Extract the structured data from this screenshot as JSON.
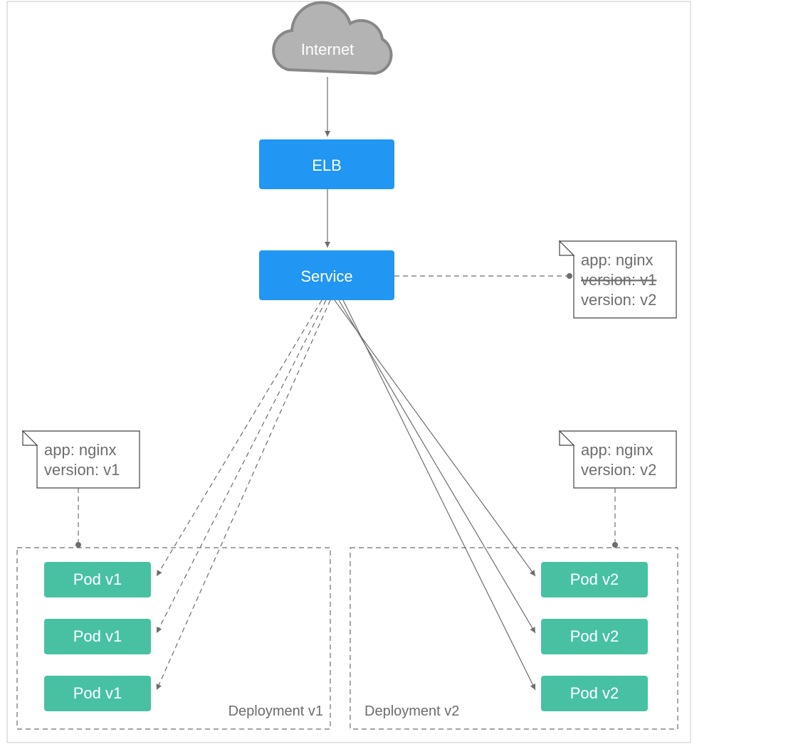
{
  "cloud": {
    "label": "Internet"
  },
  "elb": {
    "label": "ELB"
  },
  "service": {
    "label": "Service"
  },
  "serviceNote": {
    "line1": "app: nginx",
    "line2": "version: v1",
    "line3": "version: v2"
  },
  "deploymentV1": {
    "title": "Deployment v1",
    "note": {
      "line1": "app: nginx",
      "line2": "version: v1"
    },
    "pods": [
      "Pod v1",
      "Pod v1",
      "Pod v1"
    ]
  },
  "deploymentV2": {
    "title": "Deployment v2",
    "note": {
      "line1": "app: nginx",
      "line2": "version: v2"
    },
    "pods": [
      "Pod v2",
      "Pod v2",
      "Pod v2"
    ]
  }
}
